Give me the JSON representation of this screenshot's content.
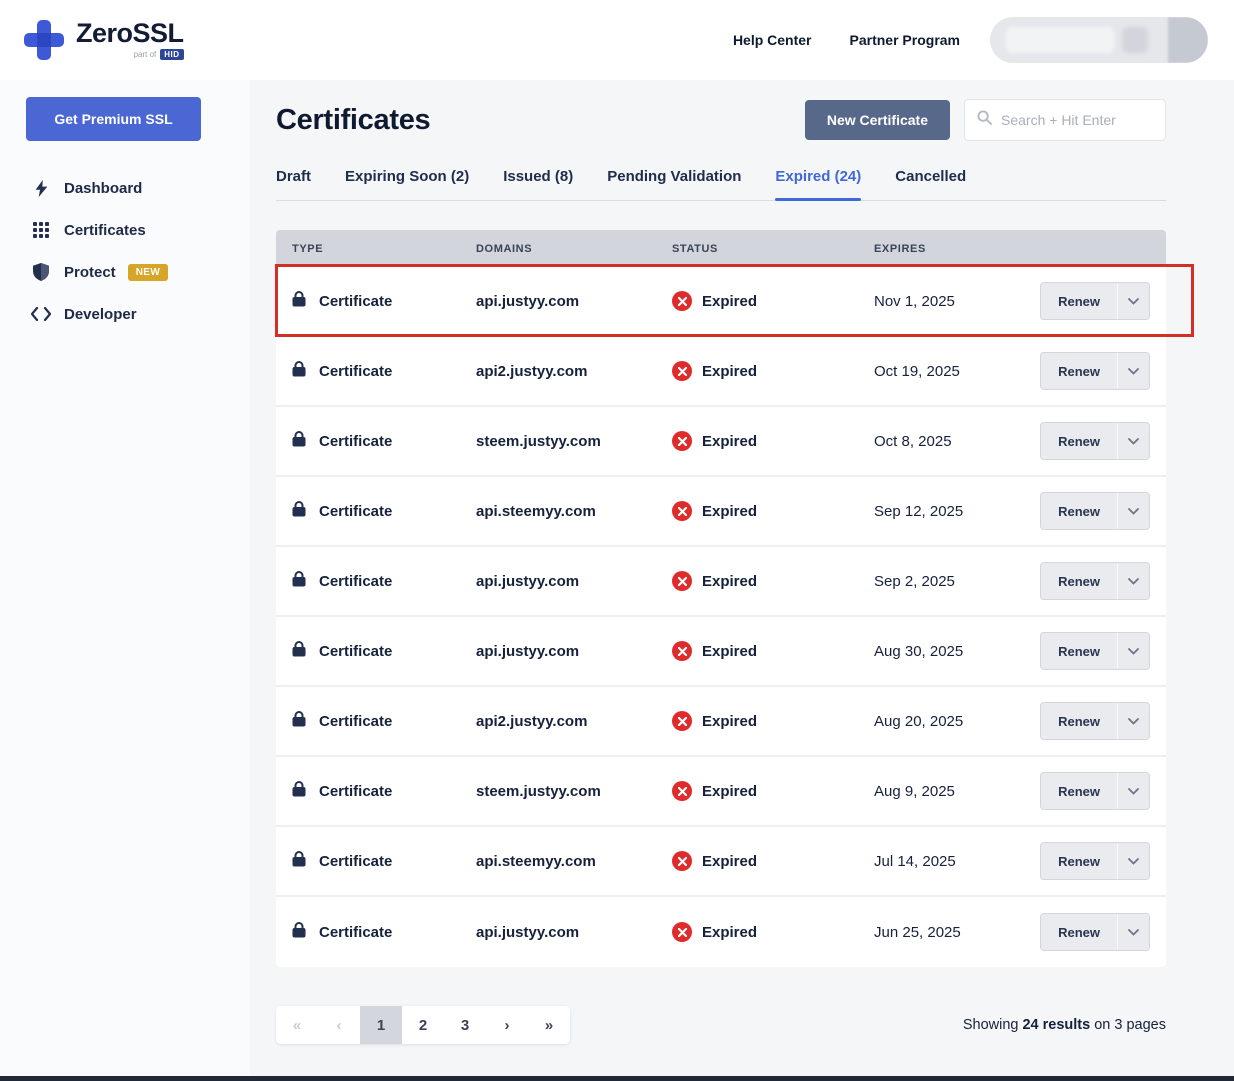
{
  "header": {
    "logo_text": "ZeroSSL",
    "logo_subtext": "part of",
    "logo_brand": "HID",
    "links": [
      {
        "label": "Help Center"
      },
      {
        "label": "Partner Program"
      }
    ]
  },
  "sidebar": {
    "premium_button": "Get Premium SSL",
    "items": [
      {
        "label": "Dashboard",
        "icon": "lightning-icon"
      },
      {
        "label": "Certificates",
        "icon": "grid-icon"
      },
      {
        "label": "Protect",
        "icon": "shield-icon",
        "badge": "NEW"
      },
      {
        "label": "Developer",
        "icon": "code-icon"
      }
    ]
  },
  "main": {
    "title": "Certificates",
    "new_certificate_button": "New Certificate",
    "search_placeholder": "Search + Hit Enter",
    "tabs": [
      {
        "label": "Draft",
        "active": false
      },
      {
        "label": "Expiring Soon (2)",
        "active": false
      },
      {
        "label": "Issued (8)",
        "active": false
      },
      {
        "label": "Pending Validation",
        "active": false
      },
      {
        "label": "Expired (24)",
        "active": true
      },
      {
        "label": "Cancelled",
        "active": false
      }
    ],
    "table": {
      "columns": [
        "TYPE",
        "DOMAINS",
        "STATUS",
        "EXPIRES"
      ],
      "renew_label": "Renew",
      "rows": [
        {
          "type": "Certificate",
          "domain": "api.justyy.com",
          "status": "Expired",
          "expires": "Nov 1, 2025",
          "highlighted": true
        },
        {
          "type": "Certificate",
          "domain": "api2.justyy.com",
          "status": "Expired",
          "expires": "Oct 19, 2025",
          "highlighted": false
        },
        {
          "type": "Certificate",
          "domain": "steem.justyy.com",
          "status": "Expired",
          "expires": "Oct 8, 2025",
          "highlighted": false
        },
        {
          "type": "Certificate",
          "domain": "api.steemyy.com",
          "status": "Expired",
          "expires": "Sep 12, 2025",
          "highlighted": false
        },
        {
          "type": "Certificate",
          "domain": "api.justyy.com",
          "status": "Expired",
          "expires": "Sep 2, 2025",
          "highlighted": false
        },
        {
          "type": "Certificate",
          "domain": "api.justyy.com",
          "status": "Expired",
          "expires": "Aug 30, 2025",
          "highlighted": false
        },
        {
          "type": "Certificate",
          "domain": "api2.justyy.com",
          "status": "Expired",
          "expires": "Aug 20, 2025",
          "highlighted": false
        },
        {
          "type": "Certificate",
          "domain": "steem.justyy.com",
          "status": "Expired",
          "expires": "Aug 9, 2025",
          "highlighted": false
        },
        {
          "type": "Certificate",
          "domain": "api.steemyy.com",
          "status": "Expired",
          "expires": "Jul 14, 2025",
          "highlighted": false
        },
        {
          "type": "Certificate",
          "domain": "api.justyy.com",
          "status": "Expired",
          "expires": "Jun 25, 2025",
          "highlighted": false
        }
      ]
    },
    "pagination": {
      "controls": [
        {
          "name": "first-page-button",
          "glyph": "«",
          "disabled": true,
          "active": false
        },
        {
          "name": "prev-page-button",
          "glyph": "‹",
          "disabled": true,
          "active": false
        },
        {
          "name": "page-1-button",
          "label": "1",
          "disabled": false,
          "active": true
        },
        {
          "name": "page-2-button",
          "label": "2",
          "disabled": false,
          "active": false
        },
        {
          "name": "page-3-button",
          "label": "3",
          "disabled": false,
          "active": false
        },
        {
          "name": "next-page-button",
          "glyph": "›",
          "disabled": false,
          "active": false
        },
        {
          "name": "last-page-button",
          "glyph": "»",
          "disabled": false,
          "active": false
        }
      ]
    },
    "results": {
      "prefix": "Showing ",
      "bold": "24 results",
      "suffix": " on 3 pages"
    }
  },
  "colors": {
    "brand_blue": "#3d59d8",
    "premium_button": "#4a67d4",
    "new_certificate_button": "#57688b",
    "active_tab": "#3f68d9",
    "expired_red": "#df2b2b",
    "new_badge": "#d7a528",
    "annotation_red": "#d22f27",
    "table_header": "#d2d5db"
  }
}
